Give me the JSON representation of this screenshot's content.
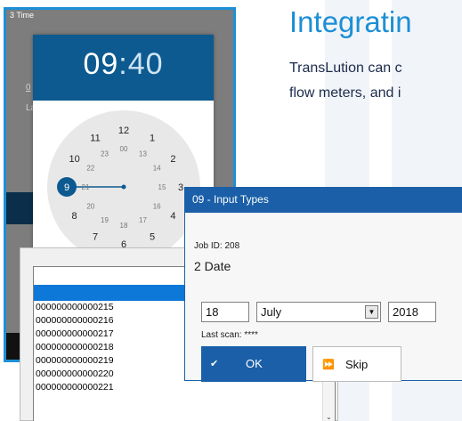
{
  "heading": "Integratin",
  "body_lines": [
    "TransLution can c",
    "flow meters, and i"
  ],
  "phone": {
    "title": "3 Time",
    "bg_left_char": "0",
    "bg_left_char2": "La",
    "picker": {
      "hours": "09",
      "colon": ":",
      "minutes": "40",
      "dial_outer": [
        "12",
        "1",
        "2",
        "3",
        "4",
        "5",
        "6",
        "7",
        "8",
        "9",
        "10",
        "11"
      ],
      "dial_inner": [
        "00",
        "13",
        "14",
        "15",
        "16",
        "17",
        "18",
        "19",
        "20",
        "21",
        "22",
        "23"
      ],
      "selected_hour": "9",
      "accent_color": "#0d5a90"
    }
  },
  "list": {
    "items": [
      "000000000000215",
      "000000000000216",
      "000000000000217",
      "000000000000218",
      "000000000000219",
      "000000000000220",
      "000000000000221"
    ],
    "scroll_arrow": "⌄"
  },
  "input_window": {
    "title": "09 - Input Types",
    "job_id": "Job ID: 208",
    "prompt": "2 Date",
    "day": "18",
    "month": "July",
    "year": "2018",
    "last_scan": "Last scan: ****",
    "ok_label": "OK",
    "skip_label": "Skip",
    "title_color": "#1a5fa8"
  }
}
